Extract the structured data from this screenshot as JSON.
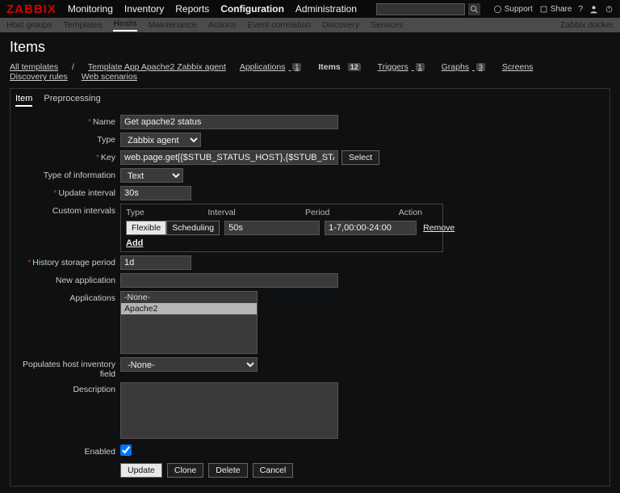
{
  "brand": "ZABBIX",
  "topnav": [
    "Monitoring",
    "Inventory",
    "Reports",
    "Configuration",
    "Administration"
  ],
  "topnav_active": 3,
  "head": {
    "support": "Support",
    "share": "Share",
    "search_placeholder": ""
  },
  "subnav": [
    "Host groups",
    "Templates",
    "Hosts",
    "Maintenance",
    "Actions",
    "Event correlation",
    "Discovery",
    "Services"
  ],
  "subnav_active": 2,
  "subnav_right": "Zabbix docker",
  "page_title": "Items",
  "crumbs": [
    {
      "label": "All templates",
      "link": true
    },
    {
      "label": "/",
      "plain": true
    },
    {
      "label": "Template App Apache2 Zabbix agent",
      "link": true
    },
    {
      "label": "Applications",
      "badge": "1",
      "link": true
    },
    {
      "label": "Items",
      "badge": "12",
      "link": false
    },
    {
      "label": "Triggers",
      "badge": "1",
      "link": true
    },
    {
      "label": "Graphs",
      "badge": "3",
      "link": true
    },
    {
      "label": "Screens",
      "link": true
    },
    {
      "label": "Discovery rules",
      "link": true
    },
    {
      "label": "Web scenarios",
      "link": true
    }
  ],
  "local_tabs": [
    "Item",
    "Preprocessing"
  ],
  "local_tab_active": 0,
  "form": {
    "name_label": "Name",
    "name_value": "Get apache2 status",
    "type_label": "Type",
    "type_value": "Zabbix agent",
    "key_label": "Key",
    "key_value": "web.page.get[{$STUB_STATUS_HOST},{$STUB_STATUS_PATH}]",
    "key_select": "Select",
    "typeinfo_label": "Type of information",
    "typeinfo_value": "Text",
    "updateint_label": "Update interval",
    "updateint_value": "30s",
    "custom_label": "Custom intervals",
    "ci_headers": [
      "Type",
      "Interval",
      "Period",
      "Action"
    ],
    "ci_flexible": "Flexible",
    "ci_scheduling": "Scheduling",
    "ci_interval": "50s",
    "ci_period": "1-7,00:00-24:00",
    "ci_remove": "Remove",
    "ci_add": "Add",
    "hist_label": "History storage period",
    "hist_value": "1d",
    "newapp_label": "New application",
    "newapp_value": "",
    "apps_label": "Applications",
    "apps_options": [
      "-None-",
      "Apache2"
    ],
    "apps_selected": 1,
    "hostinv_label": "Populates host inventory field",
    "hostinv_value": "-None-",
    "desc_label": "Description",
    "desc_value": "",
    "enabled_label": "Enabled",
    "enabled_value": true
  },
  "buttons": {
    "update": "Update",
    "clone": "Clone",
    "delete": "Delete",
    "cancel": "Cancel"
  }
}
